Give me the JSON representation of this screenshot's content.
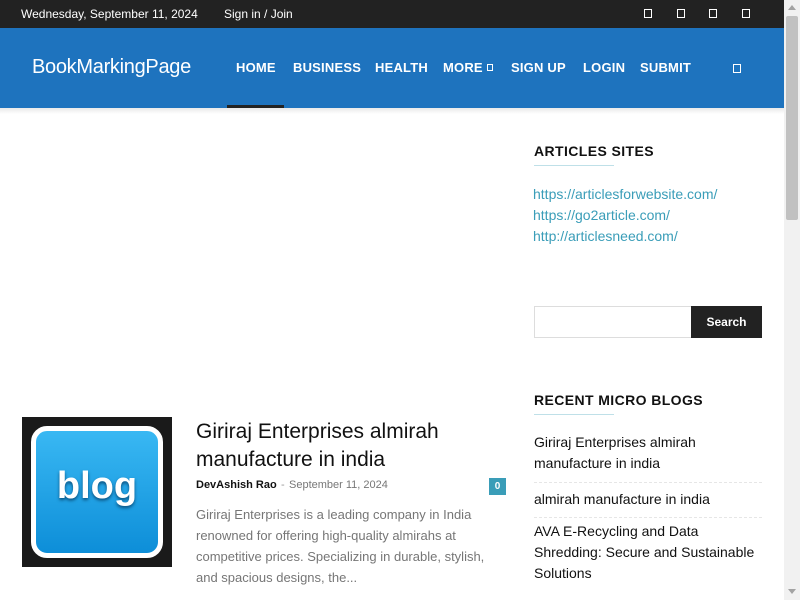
{
  "topbar": {
    "date": "Wednesday, September 11, 2024",
    "signin": "Sign in / Join",
    "social_icons": [
      "social-icon-1",
      "social-icon-2",
      "social-icon-3",
      "social-icon-4"
    ]
  },
  "header": {
    "logo": "BookMarkingPage",
    "nav": [
      "HOME",
      "BUSINESS",
      "HEALTH",
      "MORE",
      "SIGN UP",
      "LOGIN",
      "SUBMIT"
    ],
    "active_item": "HOME"
  },
  "post": {
    "thumb_text": "blog",
    "title": "Giriraj Enterprises almirah manufacture in india",
    "author": "DevAshish Rao",
    "separator": "-",
    "date": "September 11, 2024",
    "comments": "0",
    "excerpt": "Giriraj Enterprises is a leading company in India renowned for offering high-quality almirahs at competitive prices. Specializing in durable, stylish, and spacious designs, the..."
  },
  "sidebar": {
    "articles_title": "ARTICLES SITES",
    "article_links": [
      "https://articlesforwebsite.com/",
      "https://go2article.com/",
      "http://articlesneed.com/"
    ],
    "search_placeholder": "",
    "search_button": "Search",
    "recent_title": "RECENT MICRO BLOGS",
    "recent": [
      "Giriraj Enterprises almirah manufacture in india",
      "almirah manufacture in india",
      "AVA E-Recycling and Data Shredding: Secure and Sustainable Solutions"
    ]
  },
  "colors": {
    "header_bg": "#1e73be",
    "topbar_bg": "#222222",
    "link": "#3a9db8",
    "button_bg": "#222222"
  }
}
